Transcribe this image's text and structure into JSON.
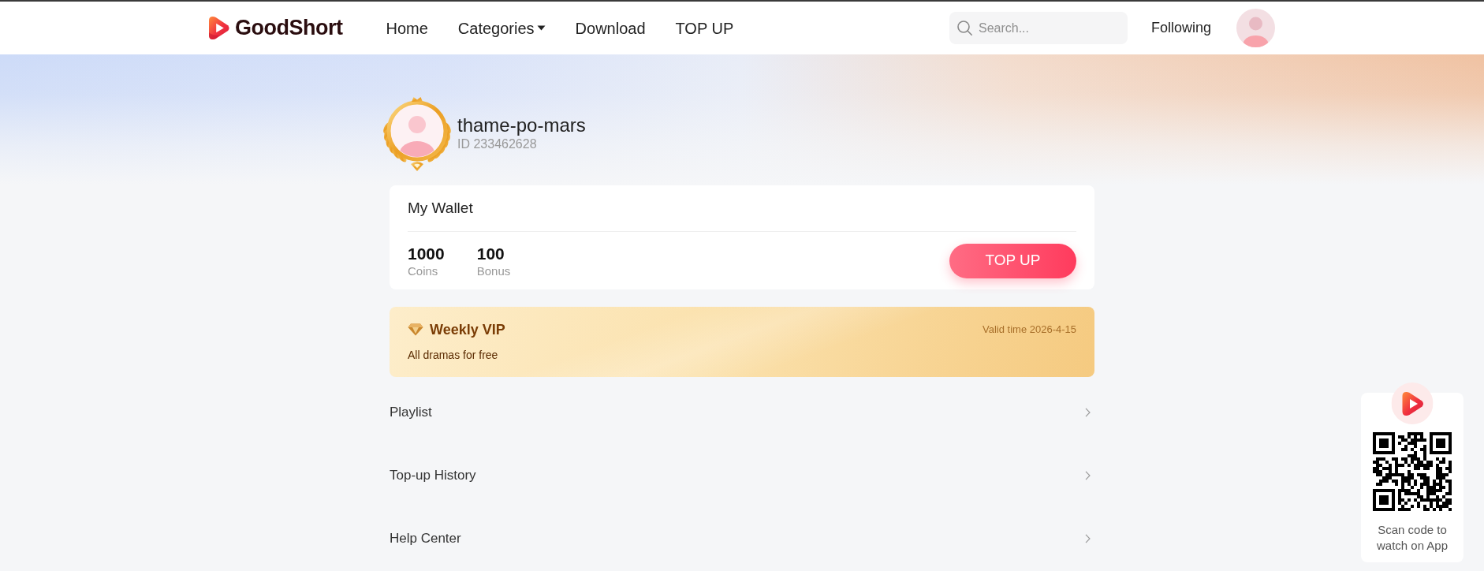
{
  "header": {
    "logo": "GoodShort",
    "nav": [
      {
        "label": "Home",
        "kind": "link"
      },
      {
        "label": "Categories",
        "kind": "dropdown"
      },
      {
        "label": "Download",
        "kind": "link"
      },
      {
        "label": "TOP UP",
        "kind": "link"
      }
    ],
    "search": {
      "placeholder": "Search..."
    },
    "following": "Following"
  },
  "profile": {
    "username": "thame-po-mars",
    "id": "ID 233462628"
  },
  "wallet": {
    "title": "My Wallet",
    "balances": [
      {
        "value": "1000",
        "label": "Coins"
      },
      {
        "value": "100",
        "label": "Bonus"
      }
    ],
    "button": "TOP UP"
  },
  "vip": {
    "title": "Weekly VIP",
    "subtitle": "All dramas for free",
    "valid": "Valid time 2026-4-15"
  },
  "menu": [
    {
      "label": "Playlist"
    },
    {
      "label": "Top-up History"
    },
    {
      "label": "Help Center"
    }
  ],
  "app_promo": {
    "caption": "Scan code to watch on App"
  }
}
